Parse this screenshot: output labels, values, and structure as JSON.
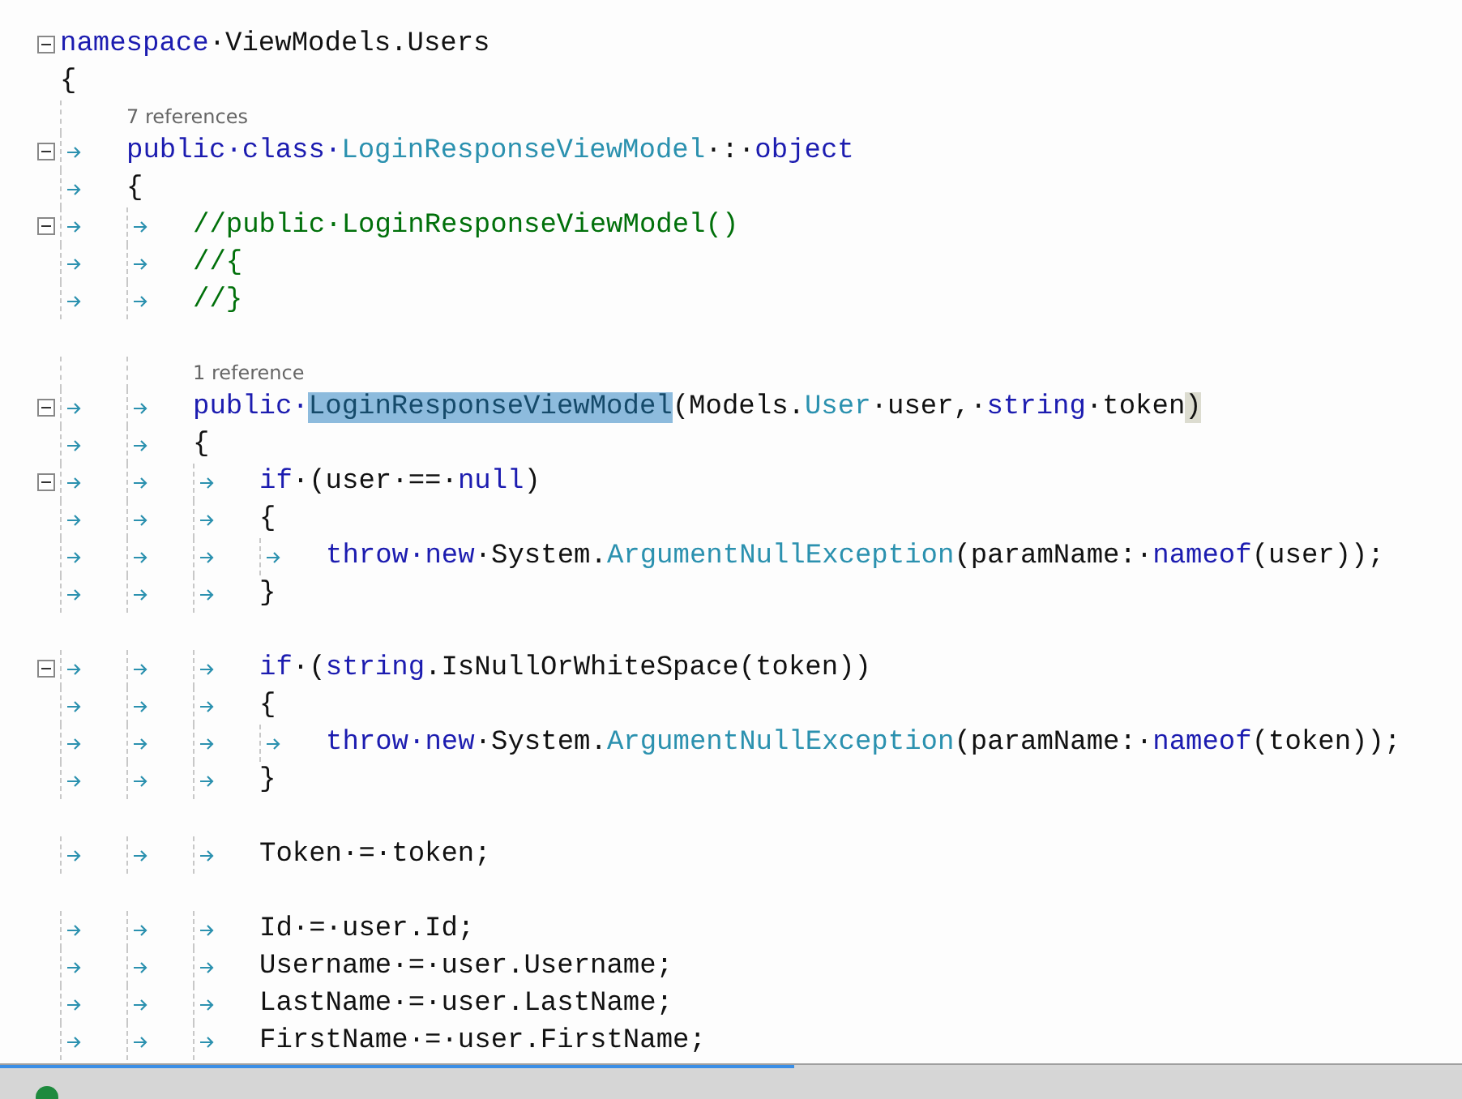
{
  "editor": {
    "lines": [
      {
        "kind": "code",
        "expanded": true,
        "tokens": [
          {
            "kind": "keyword",
            "t": "namespace"
          },
          {
            "kind": "plain",
            "t": "·ViewModels.Users"
          }
        ]
      },
      {
        "kind": "code",
        "tokens": [
          {
            "kind": "plain",
            "t": "{"
          }
        ],
        "children": [
          {
            "kind": "codelens",
            "text": "7 references"
          },
          {
            "kind": "code",
            "expanded": true,
            "tokens": [
              {
                "kind": "keyword",
                "t": "public·class·"
              },
              {
                "kind": "type",
                "t": "LoginResponseViewModel"
              },
              {
                "kind": "plain",
                "t": "·:·"
              },
              {
                "kind": "keyword",
                "t": "object"
              }
            ]
          },
          {
            "kind": "code",
            "tokens": [
              {
                "kind": "plain",
                "t": "{"
              }
            ],
            "children": [
              {
                "kind": "code",
                "expanded": true,
                "tokens": [
                  {
                    "kind": "comment",
                    "t": "//public·LoginResponseViewModel()"
                  }
                ]
              },
              {
                "kind": "code",
                "tokens": [
                  {
                    "kind": "comment",
                    "t": "//{"
                  }
                ]
              },
              {
                "kind": "code",
                "tokens": [
                  {
                    "kind": "comment",
                    "t": "//}"
                  }
                ]
              },
              {
                "kind": "blank"
              },
              {
                "kind": "codelens",
                "text": "1 reference"
              },
              {
                "kind": "code",
                "expanded": true,
                "tokens": [
                  {
                    "kind": "keyword",
                    "t": "public·"
                  },
                  {
                    "kind": "type",
                    "t": "LoginResponseViewModel",
                    "highlighted": true
                  },
                  {
                    "kind": "plain",
                    "t": "(Models."
                  },
                  {
                    "kind": "type",
                    "t": "User"
                  },
                  {
                    "kind": "plain",
                    "t": "·user,·"
                  },
                  {
                    "kind": "keyword",
                    "t": "string"
                  },
                  {
                    "kind": "plain",
                    "t": "·token"
                  },
                  {
                    "kind": "plain",
                    "t": ")",
                    "brace_matched": true
                  }
                ]
              },
              {
                "kind": "code",
                "tokens": [
                  {
                    "kind": "plain",
                    "t": "{"
                  }
                ],
                "children": [
                  {
                    "kind": "code",
                    "expanded": true,
                    "tokens": [
                      {
                        "kind": "keyword",
                        "t": "if"
                      },
                      {
                        "kind": "plain",
                        "t": "·(user·==·"
                      },
                      {
                        "kind": "keyword",
                        "t": "null"
                      },
                      {
                        "kind": "plain",
                        "t": ")"
                      }
                    ]
                  },
                  {
                    "kind": "code",
                    "tokens": [
                      {
                        "kind": "plain",
                        "t": "{"
                      }
                    ],
                    "children": [
                      {
                        "kind": "code",
                        "tokens": [
                          {
                            "kind": "keyword",
                            "t": "throw·new"
                          },
                          {
                            "kind": "plain",
                            "t": "·System."
                          },
                          {
                            "kind": "type",
                            "t": "ArgumentNullException"
                          },
                          {
                            "kind": "plain",
                            "t": "(paramName:·"
                          },
                          {
                            "kind": "keyword",
                            "t": "nameof"
                          },
                          {
                            "kind": "plain",
                            "t": "(user));"
                          }
                        ]
                      }
                    ]
                  },
                  {
                    "kind": "code",
                    "tokens": [
                      {
                        "kind": "plain",
                        "t": "}"
                      }
                    ]
                  },
                  {
                    "kind": "blank"
                  },
                  {
                    "kind": "code",
                    "expanded": true,
                    "tokens": [
                      {
                        "kind": "keyword",
                        "t": "if"
                      },
                      {
                        "kind": "plain",
                        "t": "·("
                      },
                      {
                        "kind": "keyword",
                        "t": "string"
                      },
                      {
                        "kind": "plain",
                        "t": ".IsNullOrWhiteSpace(token))"
                      }
                    ]
                  },
                  {
                    "kind": "code",
                    "tokens": [
                      {
                        "kind": "plain",
                        "t": "{"
                      }
                    ],
                    "children": [
                      {
                        "kind": "code",
                        "tokens": [
                          {
                            "kind": "keyword",
                            "t": "throw·new"
                          },
                          {
                            "kind": "plain",
                            "t": "·System."
                          },
                          {
                            "kind": "type",
                            "t": "ArgumentNullException"
                          },
                          {
                            "kind": "plain",
                            "t": "(paramName:·"
                          },
                          {
                            "kind": "keyword",
                            "t": "nameof"
                          },
                          {
                            "kind": "plain",
                            "t": "(token));"
                          }
                        ]
                      }
                    ]
                  },
                  {
                    "kind": "code",
                    "tokens": [
                      {
                        "kind": "plain",
                        "t": "}"
                      }
                    ]
                  },
                  {
                    "kind": "blank"
                  },
                  {
                    "kind": "code",
                    "tokens": [
                      {
                        "kind": "plain",
                        "t": "Token·=·token;"
                      }
                    ]
                  },
                  {
                    "kind": "blank"
                  },
                  {
                    "kind": "code",
                    "tokens": [
                      {
                        "kind": "plain",
                        "t": "Id·=·user.Id;"
                      }
                    ]
                  },
                  {
                    "kind": "code",
                    "tokens": [
                      {
                        "kind": "plain",
                        "t": "Username·=·user.Username;"
                      }
                    ]
                  },
                  {
                    "kind": "code",
                    "tokens": [
                      {
                        "kind": "plain",
                        "t": "LastName·=·user.LastName;"
                      }
                    ]
                  },
                  {
                    "kind": "code",
                    "tokens": [
                      {
                        "kind": "plain",
                        "t": "FirstName·=·user.FirstName;"
                      }
                    ]
                  }
                ]
              }
            ]
          }
        ]
      }
    ]
  }
}
